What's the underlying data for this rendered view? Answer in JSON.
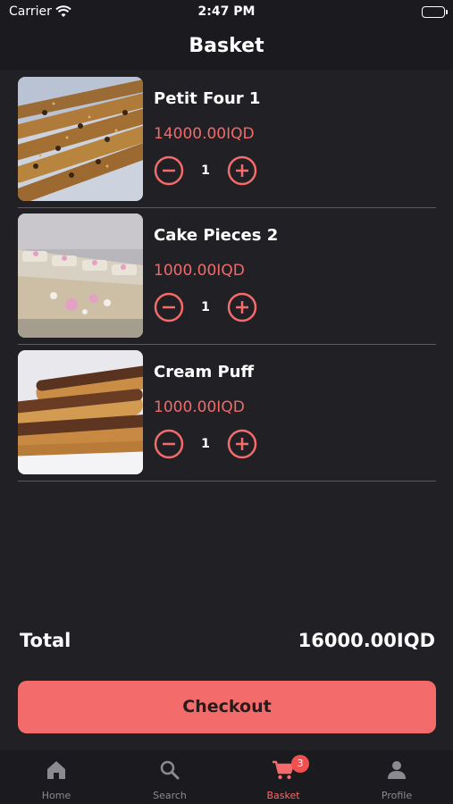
{
  "status_bar": {
    "carrier": "Carrier",
    "time": "2:47 PM"
  },
  "header": {
    "title": "Basket"
  },
  "items": [
    {
      "name": "Petit Four 1",
      "price": "14000.00IQD",
      "quantity": "1",
      "image": "pastry-bars"
    },
    {
      "name": "Cake Pieces 2",
      "price": "1000.00IQD",
      "quantity": "1",
      "image": "cake-slices"
    },
    {
      "name": "Cream Puff",
      "price": "1000.00IQD",
      "quantity": "1",
      "image": "eclairs"
    }
  ],
  "summary": {
    "total_label": "Total",
    "total_value": "16000.00IQD"
  },
  "checkout": {
    "label": "Checkout"
  },
  "tabs": [
    {
      "label": "Home",
      "icon": "home-icon",
      "active": false
    },
    {
      "label": "Search",
      "icon": "search-icon",
      "active": false
    },
    {
      "label": "Basket",
      "icon": "cart-icon",
      "active": true,
      "badge": "3"
    },
    {
      "label": "Profile",
      "icon": "profile-icon",
      "active": false
    }
  ],
  "colors": {
    "accent": "#f36b6b",
    "background": "#212125",
    "bar": "#1b1b1f"
  }
}
